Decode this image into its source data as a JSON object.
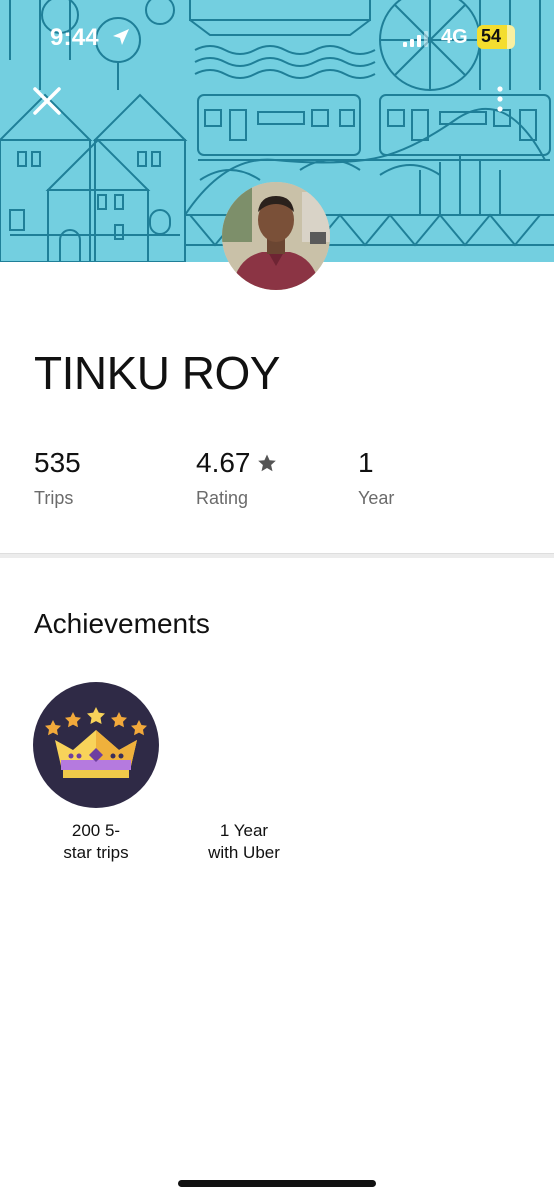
{
  "status_bar": {
    "time": "9:44",
    "network": "4G",
    "battery": "54",
    "battery_color": "#f4dd2f"
  },
  "header": {
    "background_color": "#73cfe0",
    "close_icon": "close-icon",
    "more_icon": "more-vertical-icon"
  },
  "profile": {
    "name": "TINKU ROY"
  },
  "stats": [
    {
      "value": "535",
      "label": "Trips"
    },
    {
      "value": "4.67",
      "label": "Rating",
      "icon": "star-icon"
    },
    {
      "value": "1",
      "label": "Year"
    }
  ],
  "achievements": {
    "title": "Achievements",
    "items": [
      {
        "caption": "200 5-\nstar trips",
        "icon": "crown-icon"
      },
      {
        "caption": "1 Year\nwith Uber"
      }
    ]
  }
}
